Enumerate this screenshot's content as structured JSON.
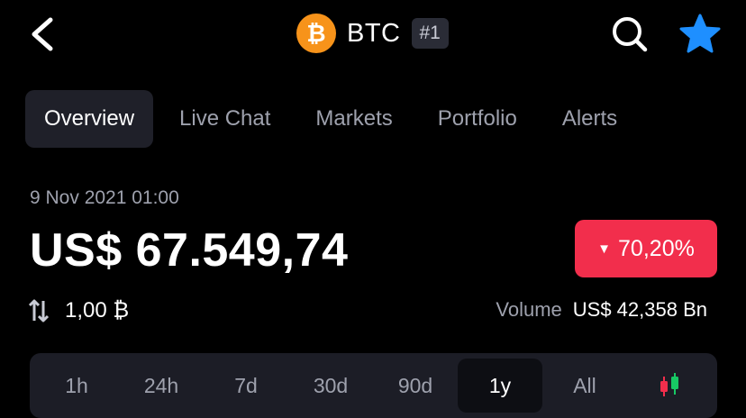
{
  "header": {
    "coin_symbol": "BTC",
    "rank": "#1",
    "coin_color": "#F7931A",
    "back_icon": "chevron-left-icon",
    "search_icon": "search-icon",
    "favorite_icon": "star-icon",
    "favorite_color": "#1E8FFF"
  },
  "tabs": [
    {
      "label": "Overview",
      "active": true
    },
    {
      "label": "Live Chat",
      "active": false
    },
    {
      "label": "Markets",
      "active": false
    },
    {
      "label": "Portfolio",
      "active": false
    },
    {
      "label": "Alerts",
      "active": false
    }
  ],
  "price_info": {
    "timestamp": "9 Nov 2021 01:00",
    "price": "US$ 67.549,74",
    "change": "70,20%",
    "change_direction": "down",
    "change_color": "#F22E4C",
    "holding": "1,00 ₿",
    "holding_icon": "swap-arrows-icon",
    "volume_label": "Volume",
    "volume_value": "US$ 42,358 Bn"
  },
  "time_ranges": [
    {
      "label": "1h",
      "active": false
    },
    {
      "label": "24h",
      "active": false
    },
    {
      "label": "7d",
      "active": false
    },
    {
      "label": "30d",
      "active": false
    },
    {
      "label": "90d",
      "active": false
    },
    {
      "label": "1y",
      "active": true
    },
    {
      "label": "All",
      "active": false
    }
  ],
  "chart_toggle_icon": "candlestick-icon"
}
